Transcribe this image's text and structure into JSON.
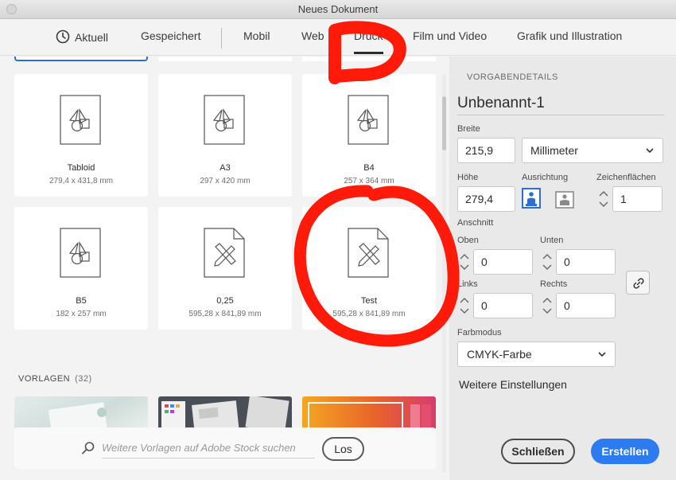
{
  "window": {
    "title": "Neues Dokument"
  },
  "tabs": [
    {
      "label": "Aktuell"
    },
    {
      "label": "Gespeichert"
    },
    {
      "label": "Mobil"
    },
    {
      "label": "Web"
    },
    {
      "label": "Druck",
      "active": true
    },
    {
      "label": "Film und Video"
    },
    {
      "label": "Grafik und Illustration"
    }
  ],
  "presets": [
    {
      "name": "Tabloid",
      "size": "279,4 x 431,8 mm",
      "icon": "shapes-document-icon"
    },
    {
      "name": "A3",
      "size": "297 x 420 mm",
      "icon": "shapes-document-icon"
    },
    {
      "name": "B4",
      "size": "257 x 364 mm",
      "icon": "shapes-document-icon"
    },
    {
      "name": "B5",
      "size": "182 x 257 mm",
      "icon": "shapes-document-icon"
    },
    {
      "name": "0,25",
      "size": "595,28 x 841,89 mm",
      "icon": "ruler-pencil-document-icon"
    },
    {
      "name": "Test",
      "size": "595,28 x 841,89 mm",
      "icon": "ruler-pencil-document-icon"
    }
  ],
  "templates": {
    "label": "VORLAGEN",
    "count": "(32)"
  },
  "search": {
    "placeholder": "Weitere Vorlagen auf Adobe Stock suchen",
    "button_label": "Los"
  },
  "details": {
    "heading": "VORGABENDETAILS",
    "document_name": "Unbenannt-1",
    "width_label": "Breite",
    "width_value": "215,9",
    "unit": "Millimeter",
    "height_label": "Höhe",
    "height_value": "279,4",
    "orientation_label": "Ausrichtung",
    "orientation_selected": "portrait",
    "artboards_label": "Zeichenflächen",
    "artboards_value": "1",
    "bleed_label": "Anschnitt",
    "bleed_top_label": "Oben",
    "bleed_top": "0",
    "bleed_bottom_label": "Unten",
    "bleed_bottom": "0",
    "bleed_left_label": "Links",
    "bleed_left": "0",
    "bleed_right_label": "Rechts",
    "bleed_right": "0",
    "color_mode_label": "Farbmodus",
    "color_mode": "CMYK-Farbe",
    "more_settings": "Weitere Einstellungen"
  },
  "actions": {
    "close_label": "Schließen",
    "create_label": "Erstellen"
  },
  "colors": {
    "accent": "#2d7bf0",
    "annotation": "#ff1a0a",
    "selection": "#2d6ed0"
  }
}
